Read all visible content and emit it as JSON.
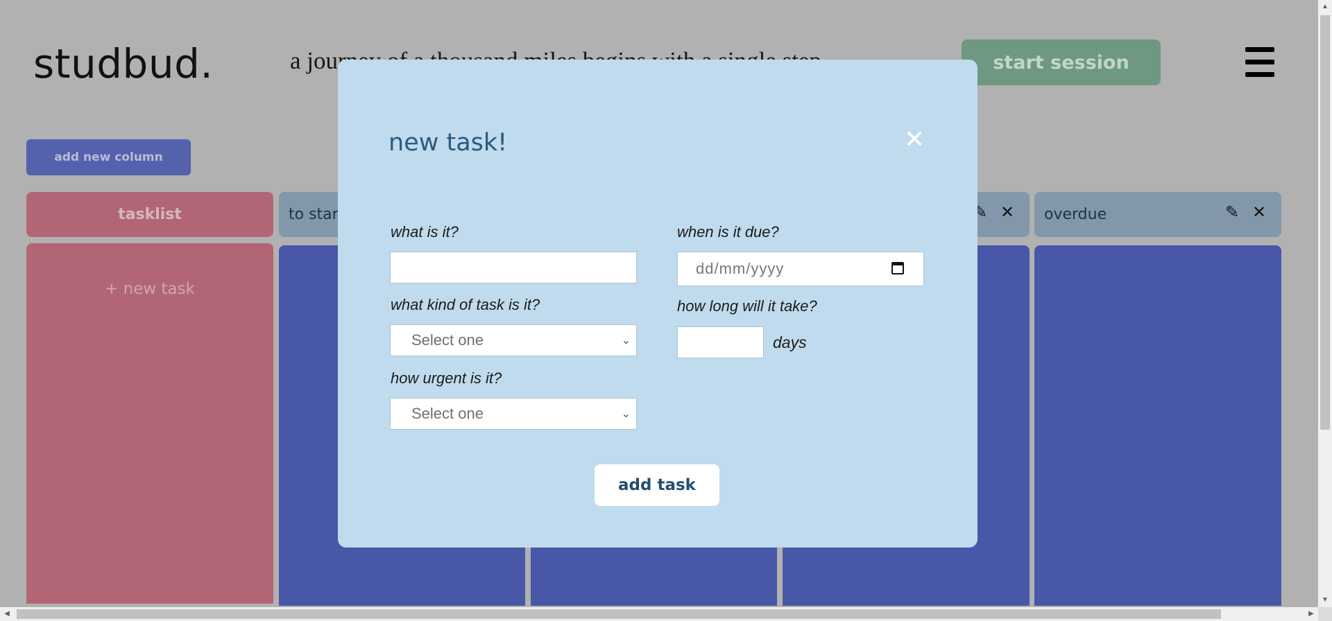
{
  "header": {
    "logo": "studbud.",
    "quote": "a journey of a thousand miles begins with a single step",
    "start_session": "start session",
    "menu_icon": "hamburger-icon"
  },
  "board": {
    "add_column_label": "add new column",
    "tasklist": {
      "title": "tasklist",
      "new_task": "+ new task"
    },
    "columns": [
      {
        "title": "to start"
      },
      {
        "title": ""
      },
      {
        "title": ""
      },
      {
        "title": "overdue"
      }
    ],
    "edit_icon": "✎",
    "close_icon": "✕"
  },
  "modal": {
    "title": "new task!",
    "close_icon": "✕",
    "fields": {
      "what_label": "what is it?",
      "what_value": "",
      "kind_label": "what kind of task is it?",
      "kind_selected": "Select one",
      "urgent_label": "how urgent is it?",
      "urgent_selected": "Select one",
      "due_label": "when is it due?",
      "due_placeholder": "dd/mm/yyyy",
      "duration_label": "how long will it take?",
      "duration_value": "",
      "duration_unit": "days"
    },
    "submit_label": "add task"
  },
  "colors": {
    "background": "#b1b1b1",
    "tasklist": "#b26675",
    "column_body": "#4957a9",
    "column_header": "#8298aa",
    "modal": "#c0dbed",
    "start_session": "#6e9881",
    "add_column": "#5461ad"
  }
}
